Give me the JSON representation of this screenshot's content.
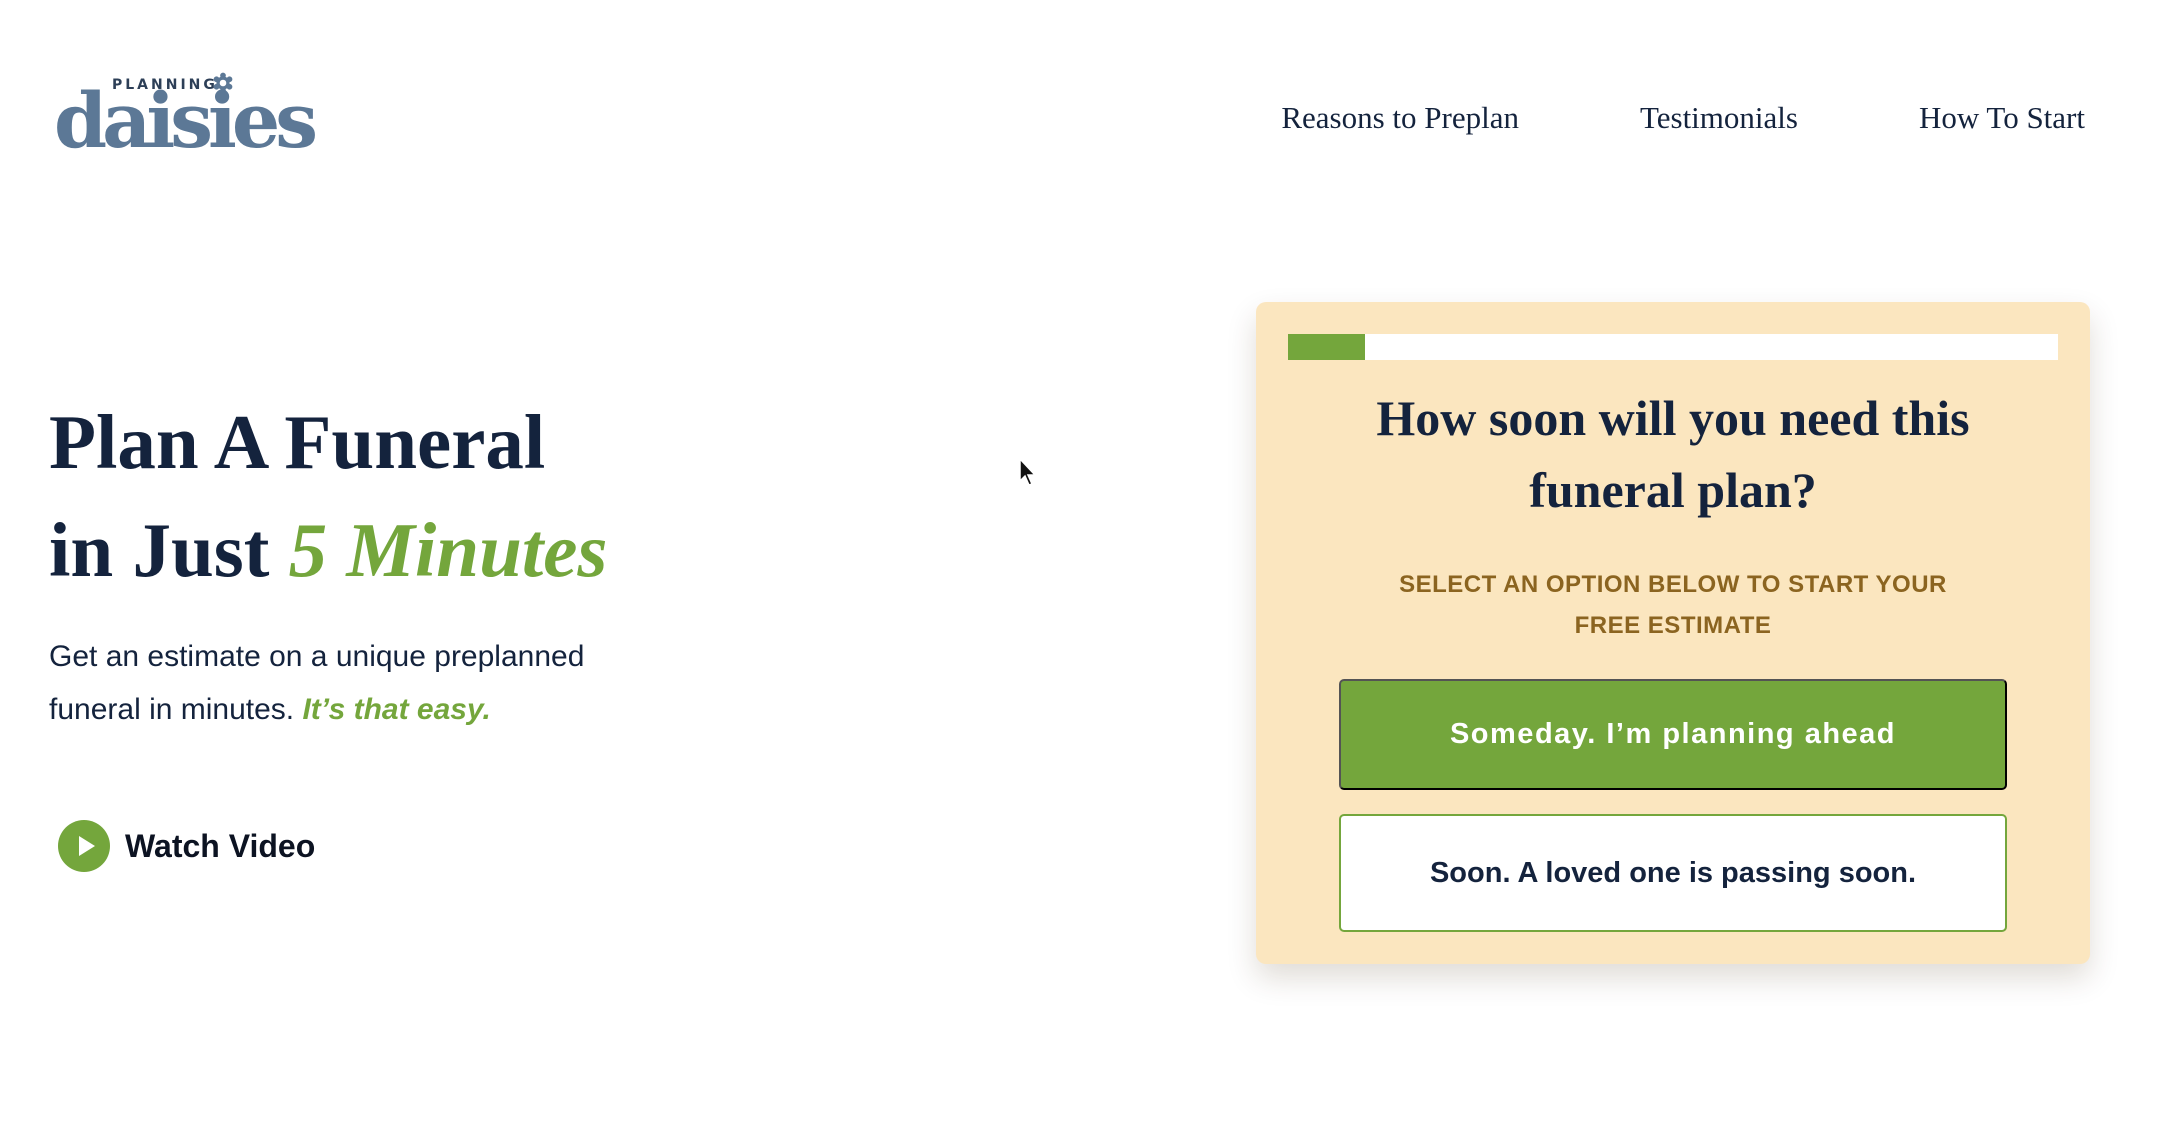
{
  "brand": {
    "logo_small_text": "PLANNING",
    "logo_main_text": "daisies",
    "logo_color": "#5c7896"
  },
  "nav": {
    "items": [
      {
        "label": "Reasons to Preplan"
      },
      {
        "label": "Testimonials"
      },
      {
        "label": "How To Start"
      }
    ]
  },
  "hero": {
    "title_line1": "Plan A Funeral",
    "title_line2_prefix": "in Just ",
    "title_line2_accent": "5 Minutes",
    "subtitle_line1": "Get an estimate on a unique preplanned",
    "subtitle_line2_prefix": "funeral in minutes. ",
    "subtitle_accent": "It’s that easy.",
    "watch_video_label": "Watch Video",
    "watch_video_icon": "play-icon"
  },
  "quiz": {
    "progress_fraction": 0.1,
    "question": "How soon will you need this funeral plan?",
    "instruction_line1": "SELECT AN OPTION BELOW TO START YOUR",
    "instruction_line2": "FREE ESTIMATE",
    "options": [
      {
        "label": "Someday. I’m planning ahead"
      },
      {
        "label": "Soon. A loved one is passing soon."
      }
    ]
  },
  "colors": {
    "accent_green": "#74a63c",
    "navy_text": "#14233d",
    "card_background": "#fbe6bf",
    "instruction_brown": "#8b6420"
  }
}
